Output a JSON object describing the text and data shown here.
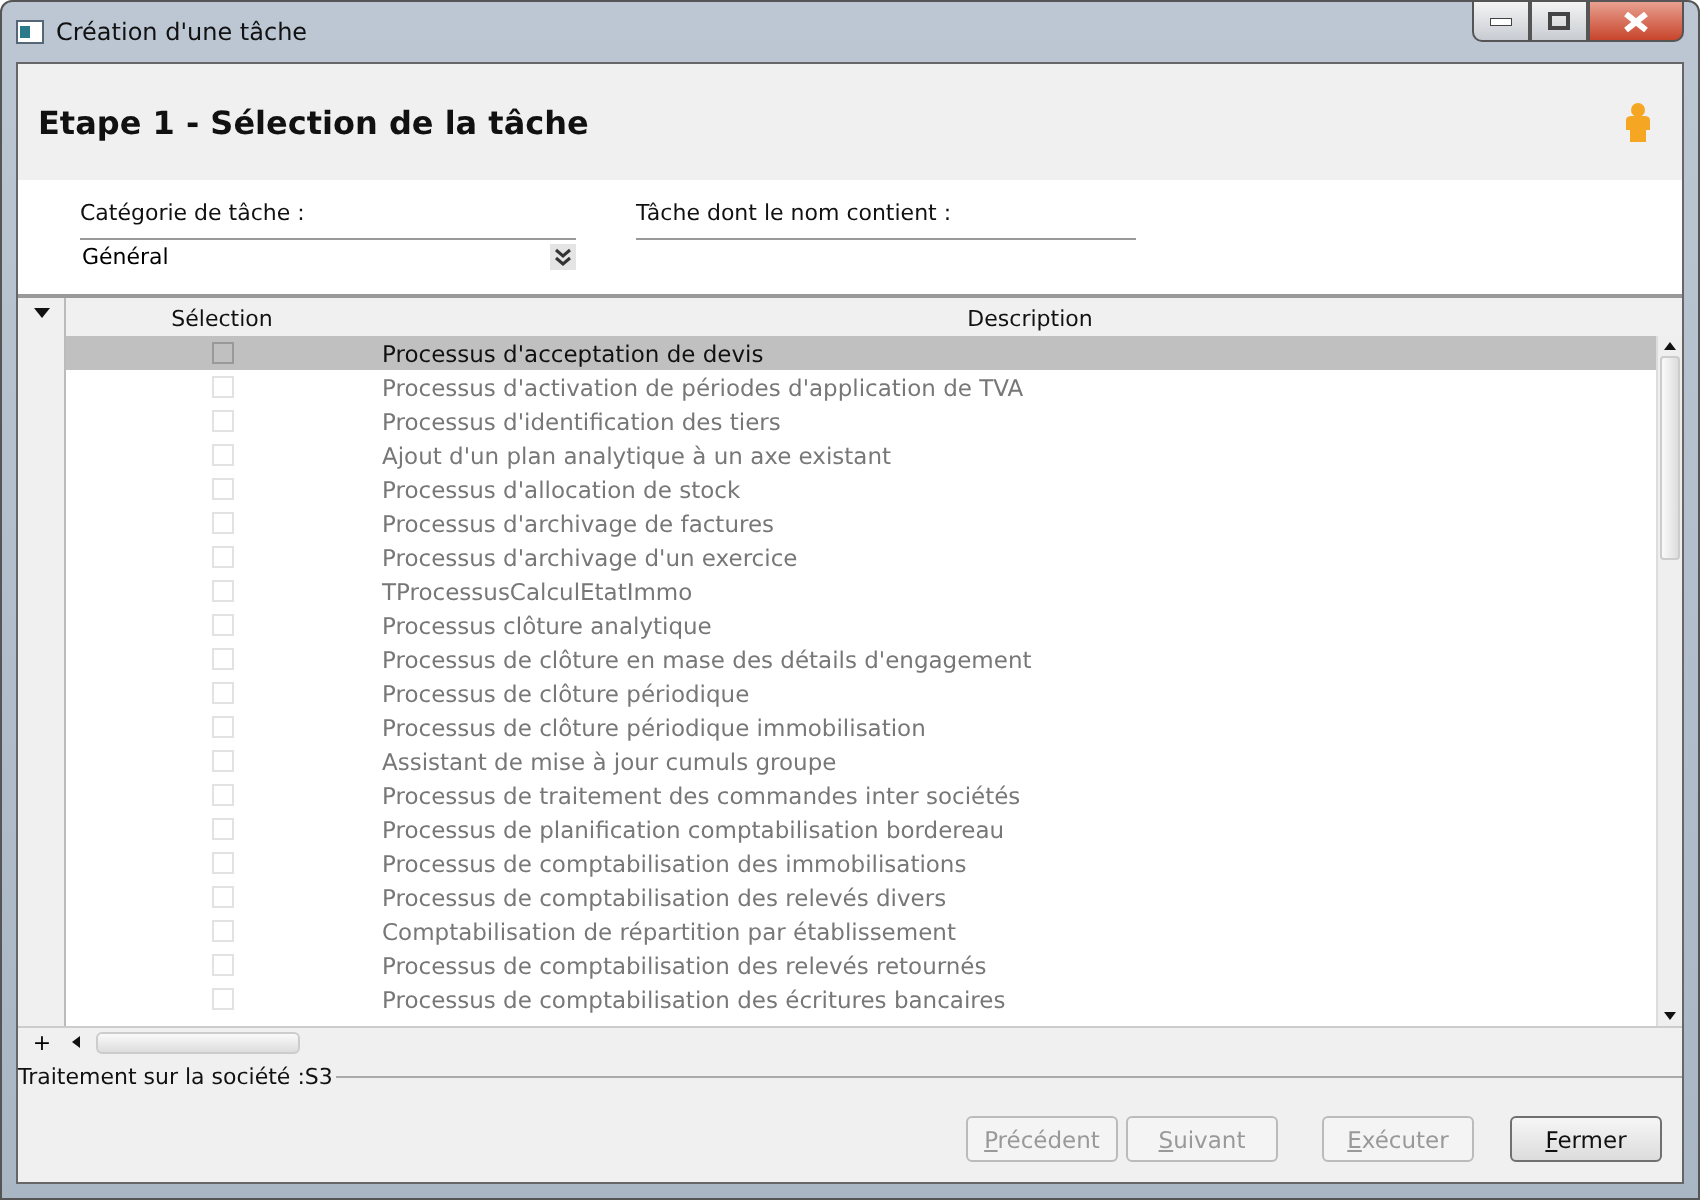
{
  "window": {
    "title": "Création d'une tâche"
  },
  "header": {
    "title": "Etape 1 - Sélection de la tâche"
  },
  "filters": {
    "category": {
      "label": "Catégorie de tâche :",
      "value": "Général"
    },
    "name_filter": {
      "label": "Tâche dont le nom contient :"
    }
  },
  "table": {
    "columns": [
      "Sélection",
      "Description"
    ],
    "rows": [
      {
        "description": "Processus d'acceptation de devis",
        "checked": false,
        "selected": true
      },
      {
        "description": "Processus d'activation de périodes d'application de TVA",
        "checked": false,
        "selected": false
      },
      {
        "description": "Processus d'identification des tiers",
        "checked": false,
        "selected": false
      },
      {
        "description": "Ajout d'un plan analytique à un axe existant",
        "checked": false,
        "selected": false
      },
      {
        "description": "Processus d'allocation de stock",
        "checked": false,
        "selected": false
      },
      {
        "description": "Processus d'archivage de factures",
        "checked": false,
        "selected": false
      },
      {
        "description": "Processus d'archivage d'un exercice",
        "checked": false,
        "selected": false
      },
      {
        "description": "TProcessusCalculEtatImmo",
        "checked": false,
        "selected": false
      },
      {
        "description": "Processus clôture analytique",
        "checked": false,
        "selected": false
      },
      {
        "description": "Processus de clôture en mase des détails d'engagement",
        "checked": false,
        "selected": false
      },
      {
        "description": "Processus de clôture périodique",
        "checked": false,
        "selected": false
      },
      {
        "description": "Processus de clôture périodique immobilisation",
        "checked": false,
        "selected": false
      },
      {
        "description": "Assistant de mise à jour cumuls groupe",
        "checked": false,
        "selected": false
      },
      {
        "description": "Processus de traitement des commandes inter sociétés",
        "checked": false,
        "selected": false
      },
      {
        "description": "Processus de planification comptabilisation bordereau",
        "checked": false,
        "selected": false
      },
      {
        "description": "Processus de comptabilisation des immobilisations",
        "checked": false,
        "selected": false
      },
      {
        "description": "Processus de comptabilisation des relevés divers",
        "checked": false,
        "selected": false
      },
      {
        "description": "Comptabilisation de répartition par établissement",
        "checked": false,
        "selected": false
      },
      {
        "description": "Processus de comptabilisation des relevés retournés",
        "checked": false,
        "selected": false
      },
      {
        "description": "Processus de comptabilisation des écritures bancaires",
        "checked": false,
        "selected": false
      }
    ],
    "expander": "+"
  },
  "status": "Traitement sur la société :S3",
  "buttons": [
    {
      "label": "Précédent",
      "disabled": true
    },
    {
      "label": "Suivant",
      "disabled": true
    },
    {
      "label": "Exécuter",
      "disabled": true
    },
    {
      "label": "Fermer",
      "disabled": false
    }
  ]
}
